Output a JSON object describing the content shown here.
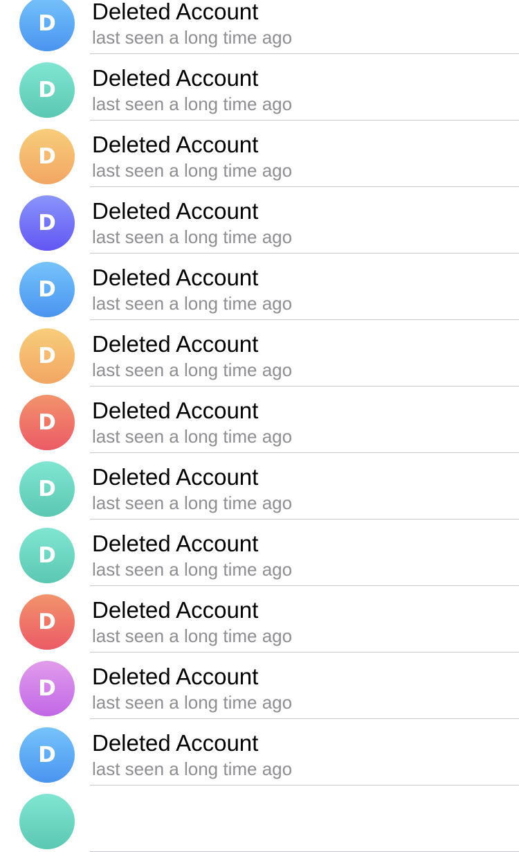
{
  "contacts": [
    {
      "initial": "D",
      "name": "Deleted Account",
      "status": "last seen a long time ago",
      "avatar_color": "blue",
      "gradient": [
        "#76c3fb",
        "#4a94f0"
      ]
    },
    {
      "initial": "D",
      "name": "Deleted Account",
      "status": "last seen a long time ago",
      "avatar_color": "green",
      "gradient": [
        "#80e6d2",
        "#5bc7b2"
      ]
    },
    {
      "initial": "D",
      "name": "Deleted Account",
      "status": "last seen a long time ago",
      "avatar_color": "orange",
      "gradient": [
        "#f8cd7b",
        "#f2a663"
      ]
    },
    {
      "initial": "D",
      "name": "Deleted Account",
      "status": "last seen a long time ago",
      "avatar_color": "violet",
      "gradient": [
        "#8a95fb",
        "#6256f4"
      ]
    },
    {
      "initial": "D",
      "name": "Deleted Account",
      "status": "last seen a long time ago",
      "avatar_color": "blue",
      "gradient": [
        "#76c3fb",
        "#4a94f0"
      ]
    },
    {
      "initial": "D",
      "name": "Deleted Account",
      "status": "last seen a long time ago",
      "avatar_color": "orange",
      "gradient": [
        "#f8cd7b",
        "#f2a663"
      ]
    },
    {
      "initial": "D",
      "name": "Deleted Account",
      "status": "last seen a long time ago",
      "avatar_color": "red",
      "gradient": [
        "#f2936c",
        "#ec5a66"
      ]
    },
    {
      "initial": "D",
      "name": "Deleted Account",
      "status": "last seen a long time ago",
      "avatar_color": "green",
      "gradient": [
        "#80e6d2",
        "#5bc7b2"
      ]
    },
    {
      "initial": "D",
      "name": "Deleted Account",
      "status": "last seen a long time ago",
      "avatar_color": "green",
      "gradient": [
        "#80e6d2",
        "#5bc7b2"
      ]
    },
    {
      "initial": "D",
      "name": "Deleted Account",
      "status": "last seen a long time ago",
      "avatar_color": "red",
      "gradient": [
        "#f2936c",
        "#ec5a66"
      ]
    },
    {
      "initial": "D",
      "name": "Deleted Account",
      "status": "last seen a long time ago",
      "avatar_color": "purple",
      "gradient": [
        "#e29ceb",
        "#c167e6"
      ]
    },
    {
      "initial": "D",
      "name": "Deleted Account",
      "status": "last seen a long time ago",
      "avatar_color": "blue",
      "gradient": [
        "#76c3fb",
        "#4a94f0"
      ]
    },
    {
      "initial": "",
      "name": "",
      "status": "",
      "avatar_color": "green",
      "gradient": [
        "#80e6d2",
        "#5bc7b2"
      ]
    }
  ]
}
